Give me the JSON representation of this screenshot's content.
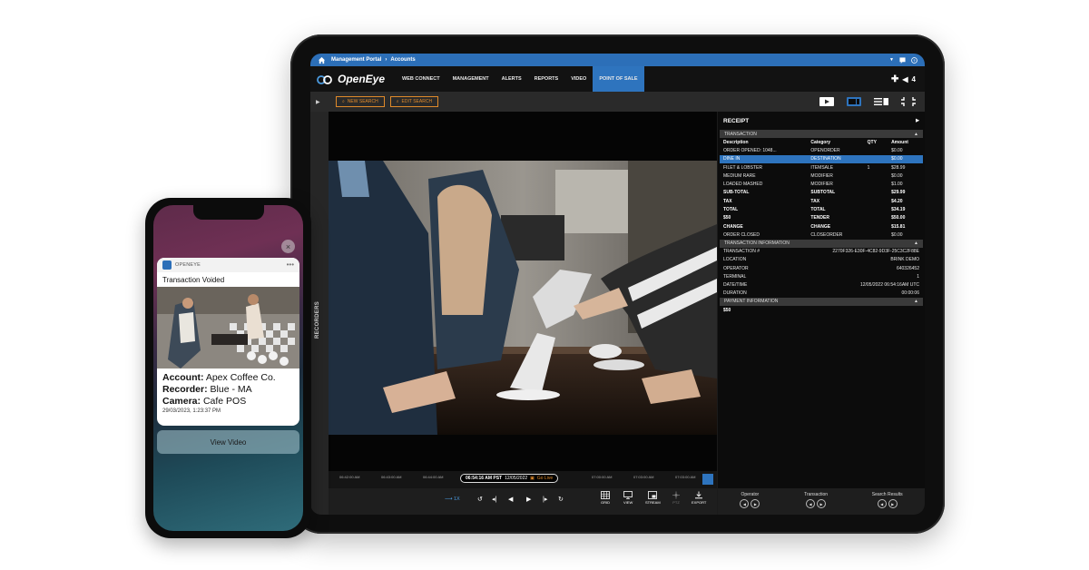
{
  "tablet": {
    "breadcrumb": {
      "root": "Management Portal",
      "current": "Accounts"
    },
    "logo_text": "OpenEye",
    "nav": [
      {
        "label": "WEB CONNECT"
      },
      {
        "label": "MANAGEMENT"
      },
      {
        "label": "ALERTS"
      },
      {
        "label": "REPORTS"
      },
      {
        "label": "VIDEO"
      },
      {
        "label": "POINT OF SALE"
      }
    ],
    "notification_count": "4",
    "toolbar": {
      "new_search": "NEW SEARCH",
      "edit_search": "EDIT SEARCH"
    },
    "side_label": "RECORDERS",
    "timeline": {
      "ticks": [
        "06:42:00 AM",
        "06:43:00 AM",
        "06:44:00 AM",
        "07:00:00 AM",
        "07:03:00 AM",
        "07:03:00 AM"
      ],
      "current_time": "06:54:16 AM PST",
      "current_date": "12/05/2022",
      "go_live": "Go Live"
    },
    "playback": {
      "speed": "1X"
    },
    "tools": [
      {
        "label": "GRID"
      },
      {
        "label": "VIEW"
      },
      {
        "label": "STREAM"
      },
      {
        "label": "PTZ"
      },
      {
        "label": "EXPORT"
      }
    ],
    "receipt": {
      "title": "RECEIPT",
      "transaction_section": "TRANSACTION",
      "columns": [
        "Description",
        "Category",
        "QTY",
        "Amount"
      ],
      "rows": [
        [
          "ORDER OPENED: 1048...",
          "OPENORDER",
          "",
          "$0.00"
        ],
        [
          "DINE IN",
          "DESTINATION",
          "",
          "$0.00"
        ],
        [
          "FILET & LOBSTER",
          "ITEMSALE",
          "1",
          "$28.99"
        ],
        [
          "MEDIUM RARE",
          "MODIFIER",
          "",
          "$0.00"
        ],
        [
          "LOADED MASHED",
          "MODIFIER",
          "",
          "$1.00"
        ],
        [
          "SUB-TOTAL",
          "SUBTOTAL",
          "",
          "$29.99"
        ],
        [
          "TAX",
          "TAX",
          "",
          "$4.20"
        ],
        [
          "TOTAL",
          "TOTAL",
          "",
          "$34.19"
        ],
        [
          "$50",
          "TENDER",
          "",
          "$50.00"
        ],
        [
          "CHANGE",
          "CHANGE",
          "",
          "$15.81"
        ],
        [
          "ORDER CLOSED",
          "CLOSEORDER",
          "",
          "$0.00"
        ]
      ],
      "info_section": "TRANSACTION INFORMATION",
      "info": [
        [
          "TRANSACTION #",
          "2270F326-E30F-4C82-9D3F-25C3C2F88E"
        ],
        [
          "LOCATION",
          "BRINK DEMO"
        ],
        [
          "OPERATOR",
          "640326452"
        ],
        [
          "TERMINAL",
          "1"
        ],
        [
          "DATE/TIME",
          "12/05/2022 06:54:16AM UTC"
        ],
        [
          "DURATION",
          "00:00:06"
        ]
      ],
      "payment_section": "PAYMENT INFORMATION",
      "payment_value": "$50",
      "footer": [
        "Operator",
        "Transaction",
        "Search Results"
      ]
    }
  },
  "phone": {
    "app_name": "OPENEYE",
    "title": "Transaction Voided",
    "account_label": "Account:",
    "account_value": "Apex Coffee Co.",
    "recorder_label": "Recorder:",
    "recorder_value": "Blue - MA",
    "camera_label": "Camera:",
    "camera_value": "Cafe POS",
    "timestamp": "29/03/2023, 1:23:37 PM",
    "action": "View Video"
  },
  "colors": {
    "accent_blue": "#2e74be",
    "accent_orange": "#e08a2a",
    "topbar_blue": "#2c6fb8"
  }
}
